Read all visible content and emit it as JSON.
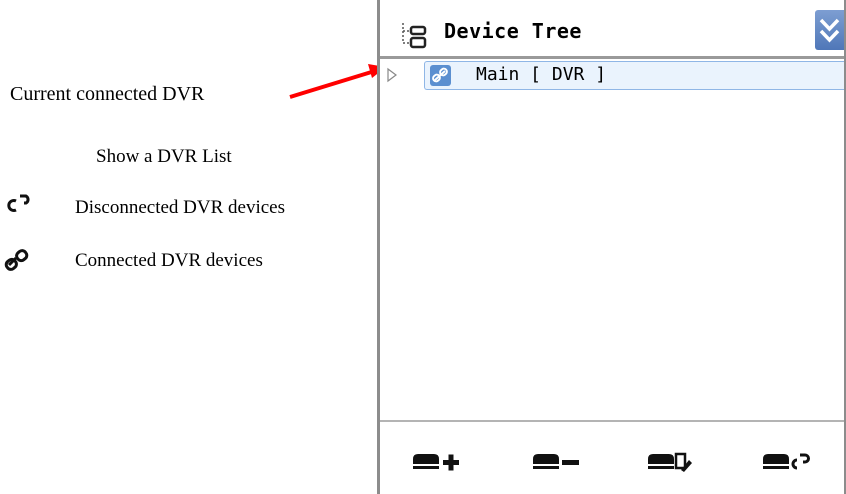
{
  "annotations": {
    "current_connected": "Current connected DVR",
    "show_list": "Show a DVR List",
    "disconnected": "Disconnected DVR devices",
    "connected": "Connected DVR devices"
  },
  "legend_icons": {
    "disconnected": "broken-link-icon",
    "connected": "link-icon"
  },
  "arrow_color": "#ff0000",
  "panel": {
    "title": "Device Tree",
    "title_icon": "tree-icon",
    "collapse_icon": "double-chevron-down-icon",
    "accent": "#5a82c3",
    "tree": [
      {
        "label": "Main [ DVR ]",
        "icon": "link-icon",
        "expander": "expand-triangle-icon",
        "selected": true
      }
    ],
    "toolbar": [
      {
        "name": "add-device-button",
        "icon": "device-add-icon"
      },
      {
        "name": "remove-device-button",
        "icon": "device-remove-icon"
      },
      {
        "name": "edit-device-button",
        "icon": "device-edit-icon"
      },
      {
        "name": "connect-device-button",
        "icon": "device-connect-icon"
      }
    ]
  }
}
